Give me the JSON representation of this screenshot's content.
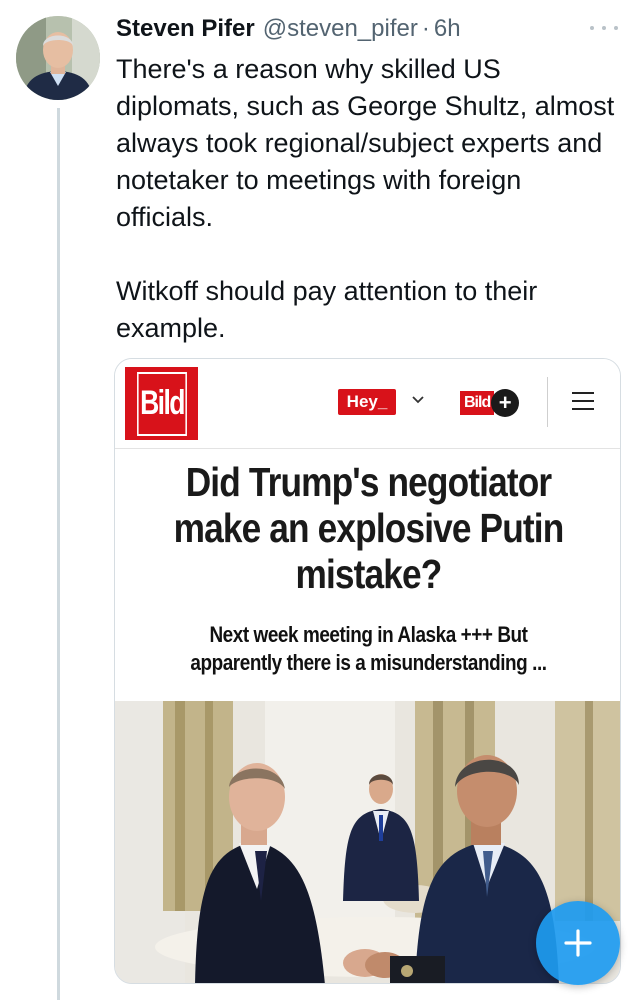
{
  "tweet": {
    "author_name": "Steven Pifer",
    "handle": "@steven_pifer",
    "separator": "·",
    "time": "6h",
    "text": "There's a reason why skilled US diplomats, such as George Shultz, almost always took regional/subject experts and notetaker to meetings with foreign officials.\n\nWitkoff should pay attention to their example."
  },
  "article_card": {
    "logo_text": "Bild",
    "hey_badge": "Hey_",
    "plus_word": "Bild",
    "plus_symbol": "+",
    "headline": "Did Trump's negotiator make an explosive Putin mistake?",
    "subheadline": "Next week meeting in Alaska +++ But apparently there is a misunderstanding ..."
  },
  "icons": {
    "more": "more-horizontal-icon",
    "chevron": "chevron-down-icon",
    "menu": "hamburger-menu-icon",
    "compose": "plus-icon"
  },
  "colors": {
    "bild_red": "#d8121a",
    "fab_blue": "#1d9bf0",
    "secondary_text": "#536471"
  }
}
